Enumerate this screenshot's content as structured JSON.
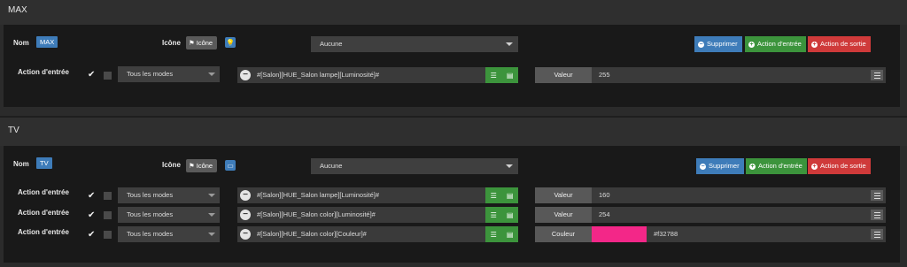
{
  "colors": {
    "panel": "#191919",
    "accent_blue": "#3e7cb9",
    "accent_green": "#3c943c",
    "accent_red": "#cf3a3a"
  },
  "labels": {
    "nom": "Nom",
    "icone": "Icône",
    "icone_button": "Icône",
    "select_default": "Aucune",
    "supprimer": "Supprimer",
    "action_entree": "Action d'entrée",
    "action_sortie": "Action de sortie",
    "action_row": "Action d'entrée",
    "mode_default": "Tous les modes"
  },
  "sections": [
    {
      "title": "MAX",
      "name_badge": "MAX",
      "icon_name": "lightbulb-icon",
      "actions": [
        {
          "command": "#[Salon][HUE_Salon lampe][Luminosité]#",
          "value_label": "Valeur",
          "value": "255",
          "checked": true
        }
      ]
    },
    {
      "title": "TV",
      "name_badge": "TV",
      "icon_name": "tv-icon",
      "actions": [
        {
          "command": "#[Salon][HUE_Salon lampe][Luminosité]#",
          "value_label": "Valeur",
          "value": "160",
          "checked": true
        },
        {
          "command": "#[Salon][HUE_Salon color][Luminosité]#",
          "value_label": "Valeur",
          "value": "254",
          "checked": true
        },
        {
          "command": "#[Salon][HUE_Salon color][Couleur]#",
          "value_label": "Couleur",
          "value": "#f32788",
          "swatch": "#f32788",
          "checked": true
        }
      ]
    }
  ]
}
